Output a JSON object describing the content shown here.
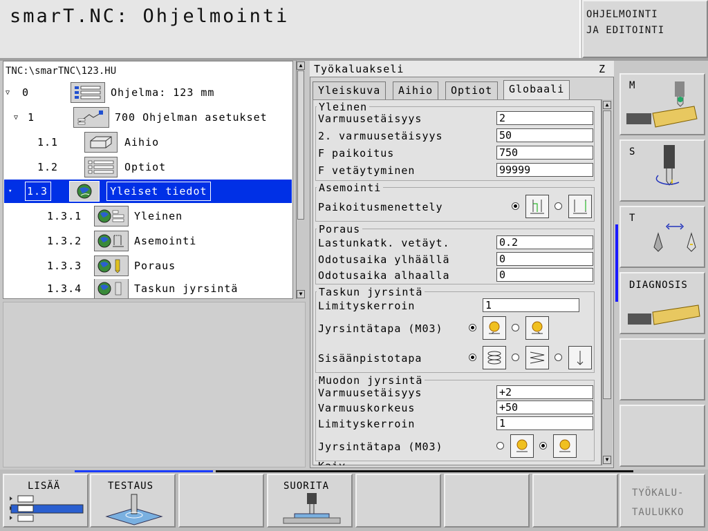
{
  "header": {
    "title": "smarT.NC: Ohjelmointi",
    "mode": "OHJELMOINTI\nJA EDITOINTI"
  },
  "tree": {
    "path": "TNC:\\smarTNC\\123.HU",
    "rows": [
      {
        "num": "0",
        "label": "Ohjelma: 123 mm",
        "icon": "program-icon"
      },
      {
        "num": "1",
        "label": "700 Ohjelman asetukset",
        "icon": "settings-icon"
      },
      {
        "num": "1.1",
        "label": "Aihio",
        "icon": "blank-icon"
      },
      {
        "num": "1.2",
        "label": "Optiot",
        "icon": "options-icon"
      },
      {
        "num": "1.3",
        "label": "Yleiset tiedot",
        "icon": "globe-icon"
      },
      {
        "num": "1.3.1",
        "label": "Yleinen",
        "icon": "globe-general-icon"
      },
      {
        "num": "1.3.2",
        "label": "Asemointi",
        "icon": "globe-positioning-icon"
      },
      {
        "num": "1.3.3",
        "label": "Poraus",
        "icon": "globe-drilling-icon"
      },
      {
        "num": "1.3.4",
        "label": "Taskun jyrsintä",
        "icon": "globe-pocket-icon"
      }
    ]
  },
  "form": {
    "title": "Työkaluakseli",
    "axis": "Z",
    "tabs": [
      "Yleiskuva",
      "Aihio",
      "Optiot",
      "Globaali"
    ],
    "groups": {
      "general": {
        "title": "Yleinen",
        "fields": [
          {
            "label": "Varmuusetäisyys",
            "value": "2"
          },
          {
            "label": "2. varmuusetäisyys",
            "value": "50"
          },
          {
            "label": "F paikoitus",
            "value": "750"
          },
          {
            "label": "F vetäytyminen",
            "value": "99999"
          }
        ]
      },
      "positioning": {
        "title": "Asemointi",
        "label": "Paikoitusmenettely"
      },
      "drilling": {
        "title": "Poraus",
        "fields": [
          {
            "label": "Lastunkatk. vetäyt.",
            "value": "0.2"
          },
          {
            "label": "Odotusaika ylhäällä",
            "value": "0"
          },
          {
            "label": "Odotusaika alhaalla",
            "value": "0"
          }
        ]
      },
      "pocket": {
        "title": "Taskun jyrsintä",
        "overlap_label": "Limityskerroin",
        "overlap_value": "1",
        "mode_label": "Jyrsintätapa (M03)",
        "plunge_label": "Sisäänpistotapa"
      },
      "contour": {
        "title": "Muodon jyrsintä",
        "fields": [
          {
            "label": "Varmuusetäisyys",
            "value": "+2"
          },
          {
            "label": "Varmuuskorkeus",
            "value": "+50"
          },
          {
            "label": "Limityskerroin",
            "value": "1"
          }
        ],
        "mode_label": "Jyrsintätapa (M03)",
        "cut_off": "Kaiv"
      }
    }
  },
  "right_softkeys": {
    "m": "M",
    "s": "S",
    "t": "T",
    "diagnosis": "DIAGNOSIS"
  },
  "bottom_softkeys": {
    "insert": "LISÄÄ",
    "test": "TESTAUS",
    "run": "SUORITA",
    "tool_table_1": "TYÖKALU-",
    "tool_table_2": "TAULUKKO"
  },
  "colors": {
    "selection": "#0030e6",
    "accent_blue": "#1a3cff"
  }
}
